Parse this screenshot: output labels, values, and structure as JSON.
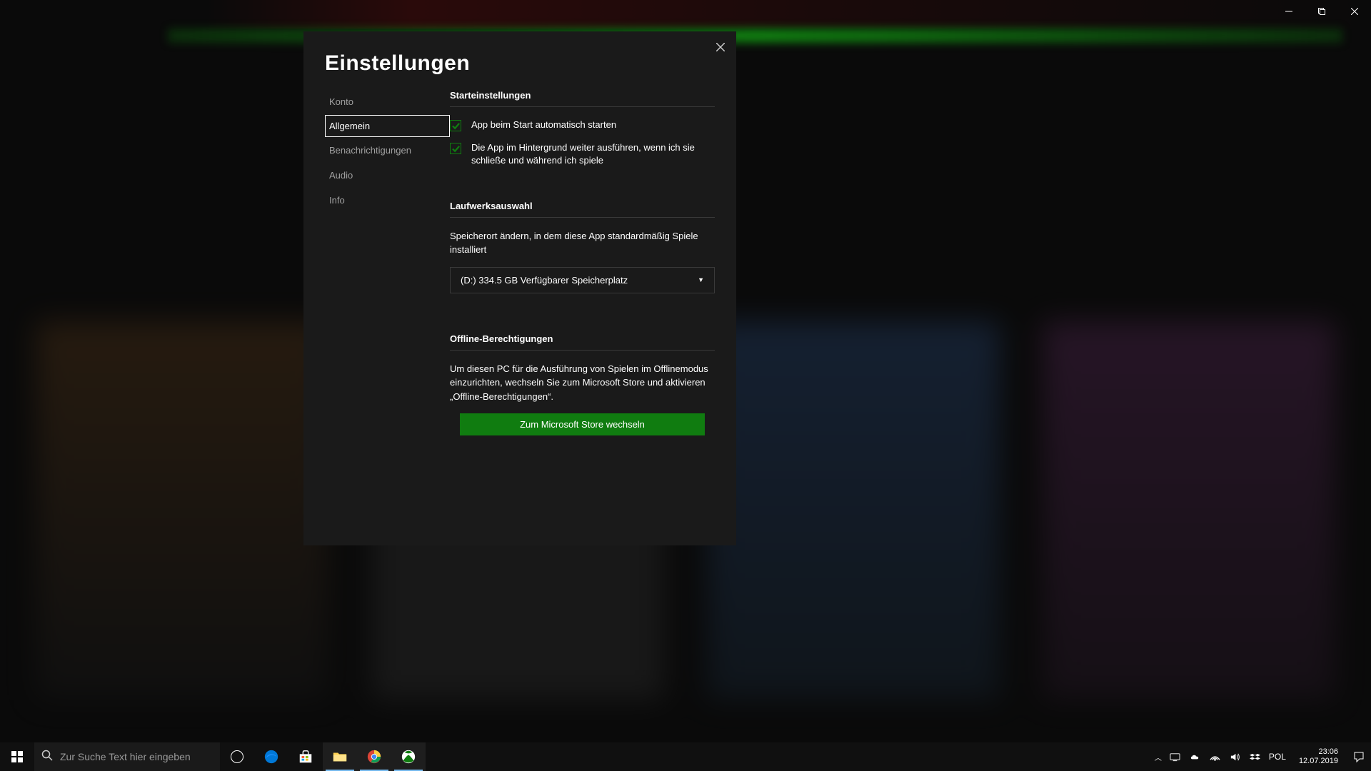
{
  "modal": {
    "title": "Einstellungen",
    "nav": {
      "items": [
        {
          "label": "Konto"
        },
        {
          "label": "Allgemein"
        },
        {
          "label": "Benachrichtigungen"
        },
        {
          "label": "Audio"
        },
        {
          "label": "Info"
        }
      ],
      "selected_index": 1
    },
    "sections": {
      "startup": {
        "header": "Starteinstellungen",
        "check1_label": "App beim Start automatisch starten",
        "check2_label": "Die App im Hintergrund weiter ausführen, wenn ich sie schließe und während ich spiele"
      },
      "drive": {
        "header": "Laufwerksauswahl",
        "desc": "Speicherort ändern, in dem diese App standardmäßig Spiele installiert",
        "selected": "(D:) 334.5 GB Verfügbarer Speicherplatz"
      },
      "offline": {
        "header": "Offline-Berechtigungen",
        "desc": "Um diesen PC für die Ausführung von Spielen im Offlinemodus einzurichten, wechseln Sie zum Microsoft Store und aktivieren „Offline-Berechtigungen“.",
        "button_label": "Zum Microsoft Store wechseln"
      }
    }
  },
  "taskbar": {
    "search_placeholder": "Zur Suche Text hier eingeben",
    "language": "POL",
    "clock_time": "23:06",
    "clock_date": "12.07.2019"
  },
  "colors": {
    "accent": "#107c10"
  }
}
